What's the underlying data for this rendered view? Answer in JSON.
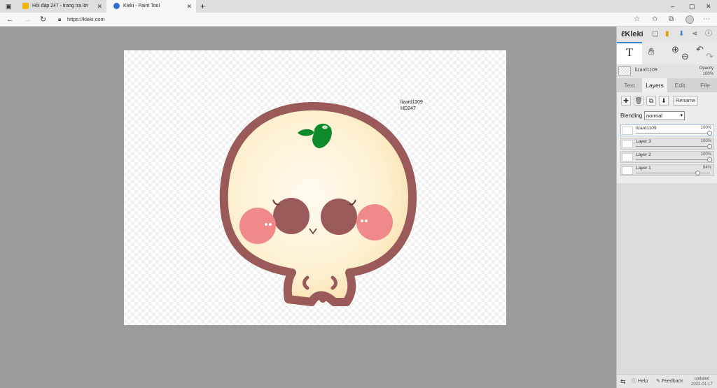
{
  "browser": {
    "tabs": [
      {
        "title": "Hỏi đáp 247 - trang tra lời",
        "active": false
      },
      {
        "title": "Kleki - Paint Tool",
        "active": true
      }
    ],
    "new_tab": "+",
    "url": "https://kleki.com",
    "window_controls": [
      "–",
      "▢",
      "✕"
    ]
  },
  "canvas": {
    "note_line1": "lizard1109",
    "note_line2": "HD247"
  },
  "panel": {
    "logo": "Kleki",
    "brush_name": "lizard1109",
    "opacity_label": "Opacity",
    "opacity_value": "100%",
    "tool_label": "T",
    "tabs": [
      "Text",
      "Layers",
      "Edit",
      "File"
    ],
    "active_tab": "Layers",
    "rename_label": "Rename",
    "blending_label": "Blending",
    "blending_value": "normal",
    "layers": [
      {
        "name": "lizard1109",
        "opacity": "100%",
        "opacity_fraction": 1.0
      },
      {
        "name": "Layer 3",
        "opacity": "100%",
        "opacity_fraction": 1.0
      },
      {
        "name": "Layer 2",
        "opacity": "100%",
        "opacity_fraction": 1.0
      },
      {
        "name": "Layer 1",
        "opacity": "84%",
        "opacity_fraction": 0.84
      }
    ],
    "bottom": {
      "help": "Help",
      "feedback": "Feedback",
      "updated_label": "updated",
      "updated_date": "2022-01-17"
    }
  },
  "colors": {
    "accent": "#3b84c9",
    "outline": "#9a5a5a",
    "face": "#fdf0cf",
    "cheek": "#f08a8a",
    "sprout": "#0e8a2a"
  }
}
